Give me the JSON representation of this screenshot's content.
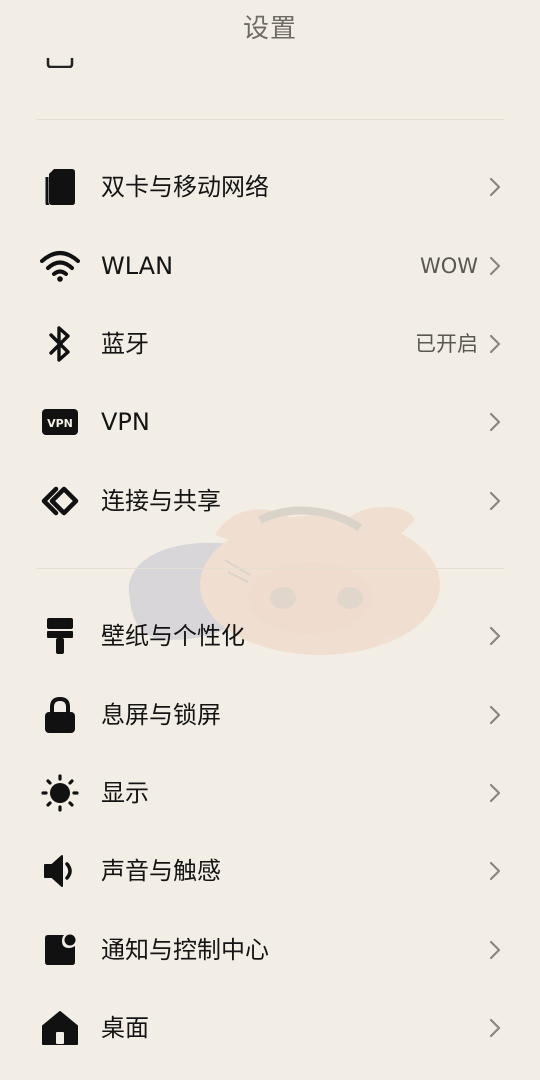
{
  "header": {
    "title": "设置"
  },
  "sections": [
    {
      "items": [
        {
          "icon": "sim-card-icon",
          "label": "双卡与移动网络",
          "value": ""
        },
        {
          "icon": "wifi-icon",
          "label": "WLAN",
          "value": "WOW"
        },
        {
          "icon": "bluetooth-icon",
          "label": "蓝牙",
          "value": "已开启"
        },
        {
          "icon": "vpn-icon",
          "label": "VPN",
          "value": ""
        },
        {
          "icon": "connection-share-icon",
          "label": "连接与共享",
          "value": ""
        }
      ]
    },
    {
      "items": [
        {
          "icon": "paint-brush-icon",
          "label": "壁纸与个性化",
          "value": ""
        },
        {
          "icon": "lock-icon",
          "label": "息屏与锁屏",
          "value": ""
        },
        {
          "icon": "brightness-icon",
          "label": "显示",
          "value": ""
        },
        {
          "icon": "speaker-icon",
          "label": "声音与触感",
          "value": ""
        },
        {
          "icon": "notification-icon",
          "label": "通知与控制中心",
          "value": ""
        },
        {
          "icon": "home-icon",
          "label": "桌面",
          "value": ""
        }
      ]
    }
  ],
  "colors": {
    "background": "#f3eee5",
    "text": "#141414",
    "secondary_text": "#5a5752",
    "title_text": "#6e6a64",
    "chevron": "#8b8780",
    "icon": "#111111"
  }
}
